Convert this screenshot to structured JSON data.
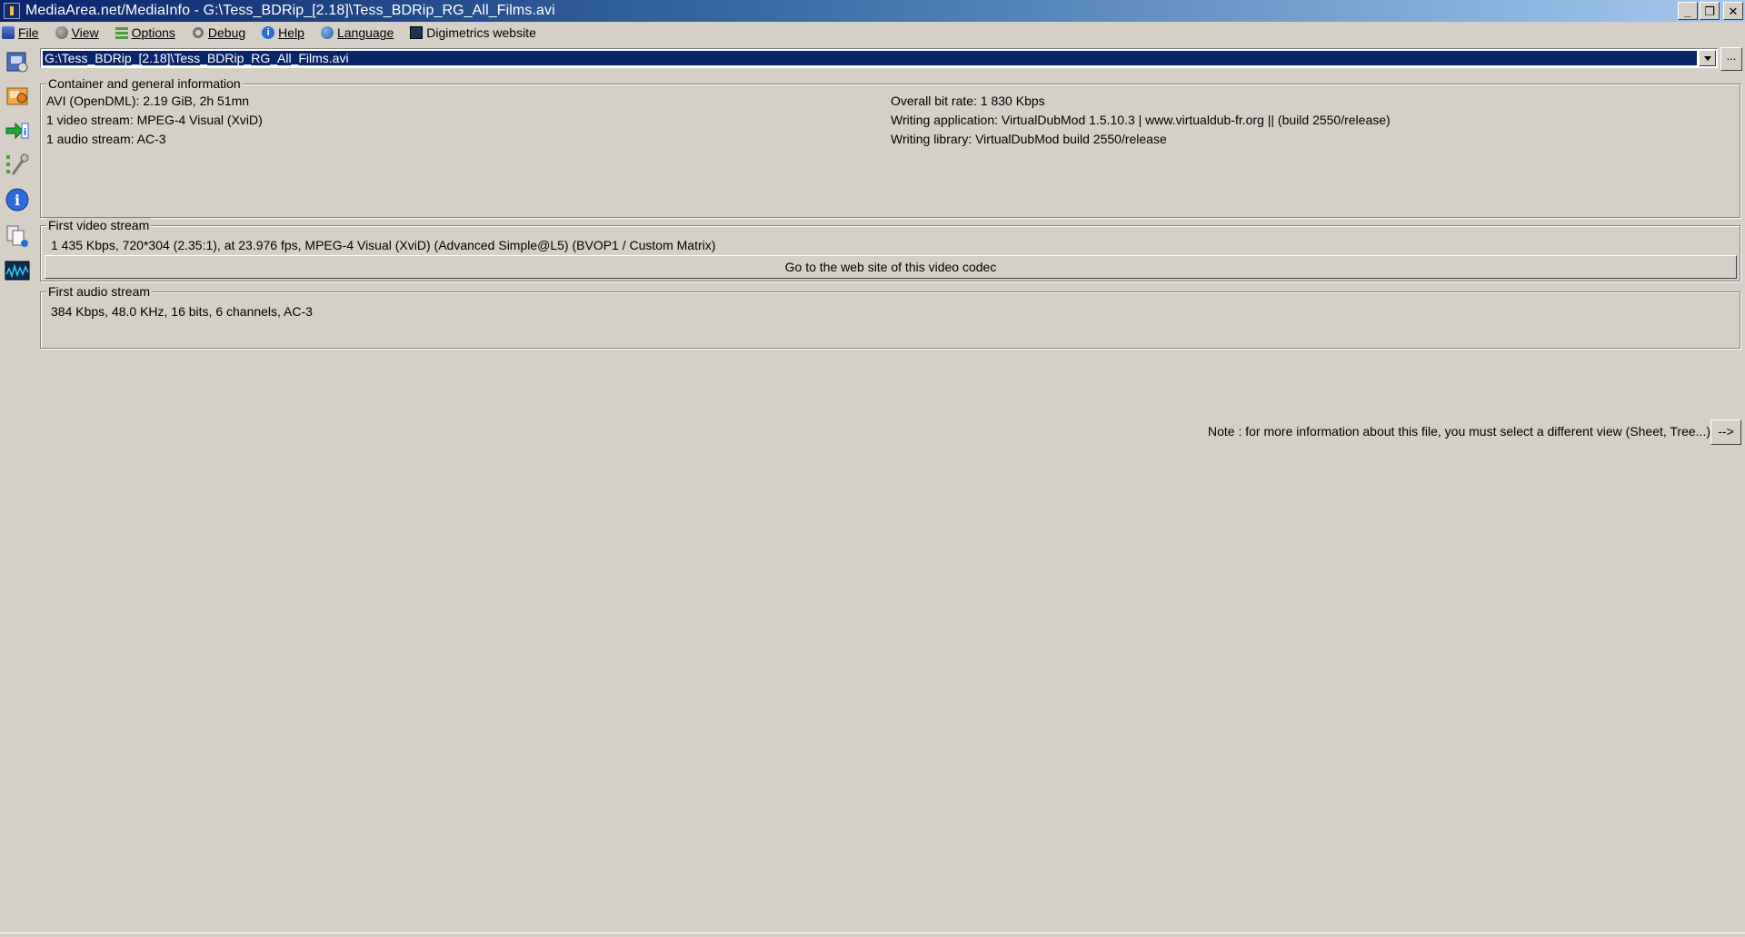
{
  "window": {
    "title": "MediaArea.net/MediaInfo - G:\\Tess_BDRip_[2.18]\\Tess_BDRip_RG_All_Films.avi",
    "minimize": "_",
    "restore": "❐",
    "close": "✕"
  },
  "menu": {
    "file": "File",
    "view": "View",
    "options": "Options",
    "debug": "Debug",
    "help": "Help",
    "language": "Language",
    "digimetrics": "Digimetrics website",
    "icons": [
      "file-icon",
      "view-icon",
      "options-icon",
      "debug-icon",
      "help-icon",
      "language-icon",
      "digimetrics-icon"
    ]
  },
  "file_selector": {
    "value": "G:\\Tess_BDRip_[2.18]\\Tess_BDRip_RG_All_Films.avi",
    "browse_label": "..."
  },
  "general": {
    "title": "Container and general information",
    "left": [
      "AVI (OpenDML): 2.19 GiB, 2h 51mn",
      "1 video stream: MPEG-4 Visual (XviD)",
      "1 audio stream: AC-3"
    ],
    "right": [
      "Overall bit rate: 1 830 Kbps",
      "Writing application: VirtualDubMod 1.5.10.3 | www.virtualdub-fr.org || (build 2550/release)",
      "Writing library: VirtualDubMod build 2550/release"
    ]
  },
  "video": {
    "title": "First video stream",
    "info": "1 435 Kbps, 720*304 (2.35:1), at 23.976 fps, MPEG-4 Visual (XviD) (Advanced Simple@L5) (BVOP1 / Custom Matrix)",
    "codec_button": "Go to the web site of this video codec"
  },
  "audio": {
    "title": "First audio stream",
    "info": "384 Kbps, 48.0 KHz, 16 bits, 6 channels, AC-3"
  },
  "note": {
    "text": "Note : for more information about this file, you must select a different view (Sheet, Tree...)",
    "button": "-->"
  },
  "colors": {
    "background": "#d4d0c8",
    "title_gradient_start": "#0a246a",
    "title_gradient_end": "#a6caf0",
    "selection": "#0a246a"
  }
}
